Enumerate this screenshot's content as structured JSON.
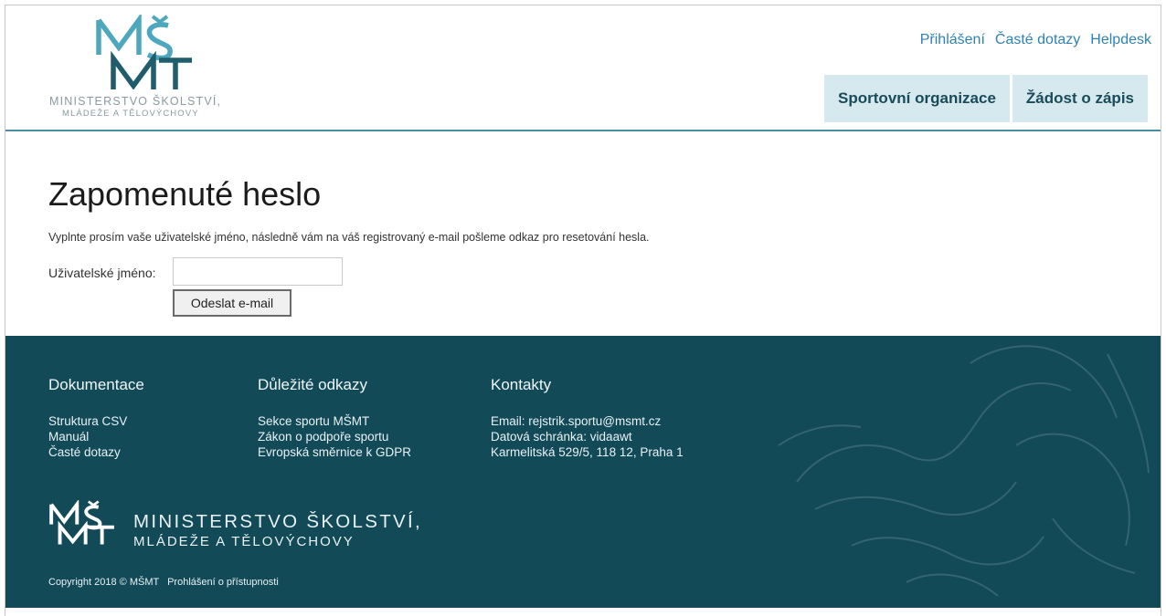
{
  "header": {
    "logo_line1": "MINISTERSTVO ŠKOLSTVÍ,",
    "logo_line2": "MLÁDEŽE A TĚLOVÝCHOVY",
    "top_links": [
      "Přihlášení",
      "Časté dotazy",
      "Helpdesk"
    ],
    "nav_tabs": [
      "Sportovní organizace",
      "Žádost o zápis"
    ]
  },
  "main": {
    "title": "Zapomenuté heslo",
    "intro": "Vyplnte prosím vaše uživatelské jméno, následně vám na váš registrovaný e-mail pošleme odkaz pro resetování hesla.",
    "username_label": "Uživatelské jméno:",
    "username_value": "",
    "submit_label": "Odeslat e-mail"
  },
  "footer": {
    "columns": [
      {
        "heading": "Dokumentace",
        "items": [
          "Struktura CSV",
          "Manuál",
          "Časté dotazy"
        ]
      },
      {
        "heading": "Důležité odkazy",
        "items": [
          "Sekce sportu MŠMT",
          "Zákon o podpoře sportu",
          "Evropská směrnice k GDPR"
        ]
      },
      {
        "heading": "Kontakty",
        "items": [
          "Email: rejstrik.sportu@msmt.cz",
          "Datová schránka: vidaawt",
          "Karmelitská 529/5, 118 12, Praha 1"
        ]
      }
    ],
    "logo_line1": "MINISTERSTVO ŠKOLSTVÍ,",
    "logo_line2": "MLÁDEŽE A TĚLOVÝCHOVY",
    "copyright": "Copyright 2018 © MŠMT",
    "accessibility_link": "Prohlášení o přístupnosti"
  },
  "colors": {
    "accent": "#4a8fa3",
    "link": "#2f82b5",
    "nav_tab_bg": "#d5e9ee",
    "footer_bg": "#124a58"
  }
}
